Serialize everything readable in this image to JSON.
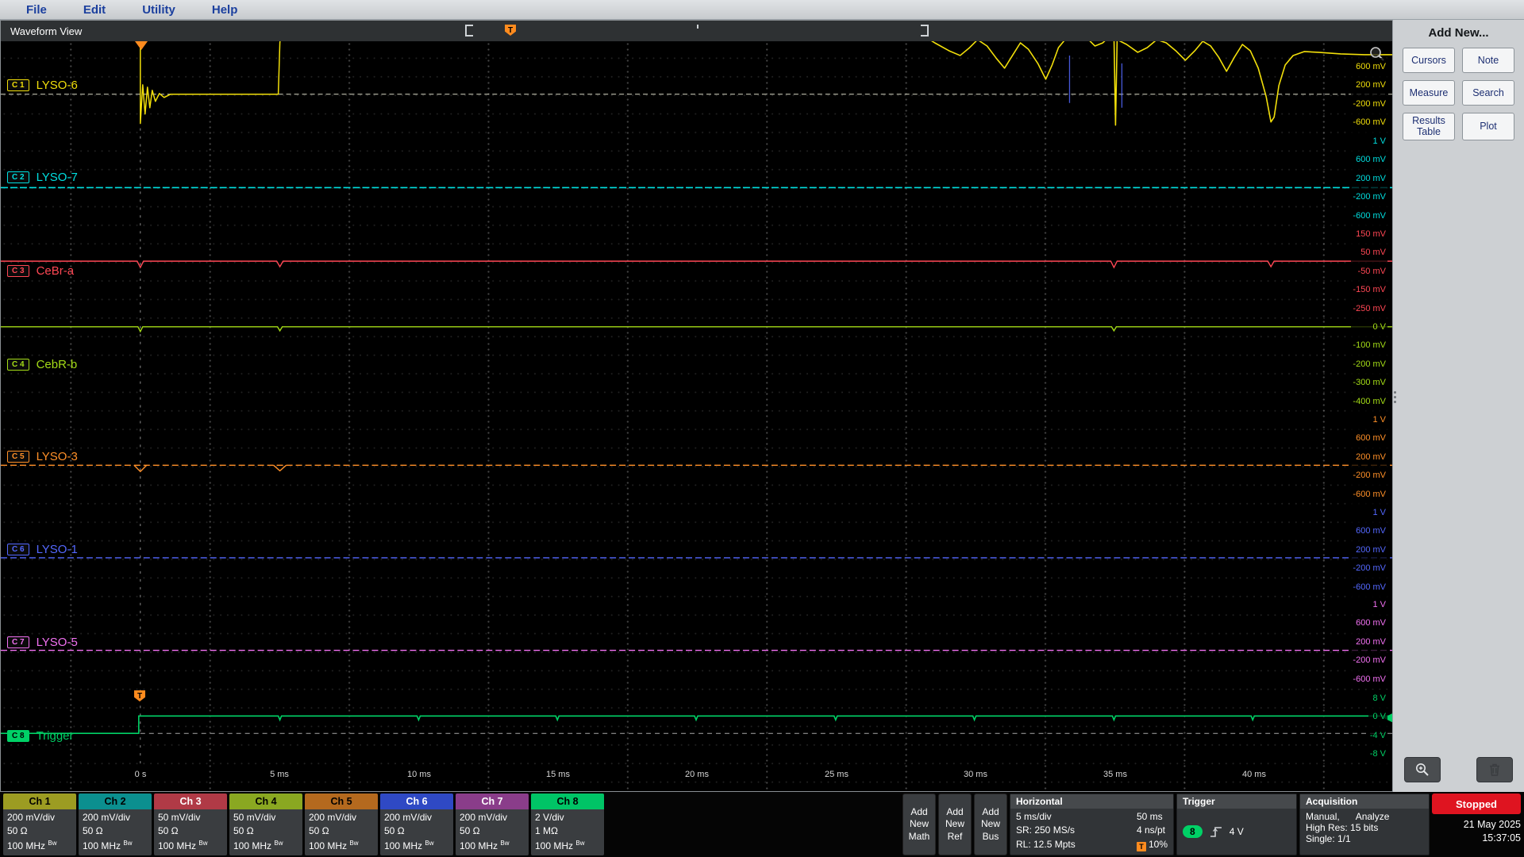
{
  "menu": {
    "items": [
      "File",
      "Edit",
      "Utility",
      "Help"
    ]
  },
  "waveform_view": {
    "title": "Waveform View"
  },
  "sidebar": {
    "title": "Add New...",
    "buttons": [
      "Cursors",
      "Note",
      "Measure",
      "Search",
      "Results Table",
      "Plot"
    ]
  },
  "plot": {
    "channels": [
      {
        "badge": "C 1",
        "name": "LYSO-6",
        "color": "#f2df0a",
        "scale_labels": [
          "600 mV",
          "200 mV",
          "-200 mV",
          "-600 mV"
        ]
      },
      {
        "badge": "C 2",
        "name": "LYSO-7",
        "color": "#00dfe0",
        "scale_labels": [
          "1 V",
          "600 mV",
          "200 mV",
          "-200 mV",
          "-600 mV"
        ]
      },
      {
        "badge": "C 3",
        "name": "CeBr-a",
        "color": "#ff4754",
        "scale_labels": [
          "150 mV",
          "50 mV",
          "-50 mV",
          "-150 mV",
          "-250 mV"
        ]
      },
      {
        "badge": "C 4",
        "name": "CebR-b",
        "color": "#a4dc17",
        "scale_labels": [
          "0 V",
          "-100 mV",
          "-200 mV",
          "-300 mV",
          "-400 mV"
        ]
      },
      {
        "badge": "C 5",
        "name": "LYSO-3",
        "color": "#ff9028",
        "scale_labels": [
          "1 V",
          "600 mV",
          "200 mV",
          "-200 mV",
          "-600 mV"
        ]
      },
      {
        "badge": "C 6",
        "name": "LYSO-1",
        "color": "#5468ff",
        "scale_labels": [
          "1 V",
          "600 mV",
          "200 mV",
          "-200 mV",
          "-600 mV"
        ]
      },
      {
        "badge": "C 7",
        "name": "LYSO-5",
        "color": "#f271f2",
        "scale_labels": [
          "1 V",
          "600 mV",
          "200 mV",
          "-200 mV",
          "-600 mV"
        ]
      },
      {
        "badge": "C 8",
        "name": "Trigger",
        "color": "#00d166",
        "scale_labels": [
          "8 V",
          "",
          "0 V",
          "-4 V",
          "-8 V"
        ]
      }
    ],
    "time_labels": [
      "0 s",
      "5 ms",
      "10 ms",
      "15 ms",
      "20 ms",
      "25 ms",
      "30 ms",
      "35 ms",
      "40 ms"
    ],
    "trigger_marker": {
      "label": "T",
      "color": "#ff8b1e"
    }
  },
  "bottom": {
    "channels": [
      {
        "label": "Ch 1",
        "scale": "200 mV/div",
        "impedance": "50 Ω",
        "bandwidth": "100 MHz",
        "bw": "Bw",
        "color": "#9c9c22"
      },
      {
        "label": "Ch 2",
        "scale": "200 mV/div",
        "impedance": "50 Ω",
        "bandwidth": "100 MHz",
        "bw": "Bw",
        "color": "#0b8f8f"
      },
      {
        "label": "Ch 3",
        "scale": "50 mV/div",
        "impedance": "50 Ω",
        "bandwidth": "100 MHz",
        "bw": "Bw",
        "color": "#b03a46"
      },
      {
        "label": "Ch 4",
        "scale": "50 mV/div",
        "impedance": "50 Ω",
        "bandwidth": "100 MHz",
        "bw": "Bw",
        "color": "#8aa821"
      },
      {
        "label": "Ch 5",
        "scale": "200 mV/div",
        "impedance": "50 Ω",
        "bandwidth": "100 MHz",
        "bw": "Bw",
        "color": "#b4691e"
      },
      {
        "label": "Ch 6",
        "scale": "200 mV/div",
        "impedance": "50 Ω",
        "bandwidth": "100 MHz",
        "bw": "Bw",
        "color": "#2f49c4"
      },
      {
        "label": "Ch 7",
        "scale": "200 mV/div",
        "impedance": "50 Ω",
        "bandwidth": "100 MHz",
        "bw": "Bw",
        "color": "#8a3d8a"
      },
      {
        "label": "Ch 8",
        "scale": "2 V/div",
        "impedance": "1 MΩ",
        "bandwidth": "100 MHz",
        "bw": "Bw",
        "color": "#00c466"
      }
    ],
    "add_buttons": [
      "Add\nNew\nMath",
      "Add\nNew\nRef",
      "Add\nNew\nBus"
    ],
    "horizontal": {
      "title": "Horizontal",
      "scale": "5 ms/div",
      "window": "50 ms",
      "sample_rate": "SR: 250 MS/s",
      "sample_interval": "4 ns/pt",
      "record_length": "RL: 12.5 Mpts",
      "position_icon": "T",
      "position": "10%"
    },
    "trigger": {
      "title": "Trigger",
      "source_badge": "8",
      "level": "4 V"
    },
    "acquisition": {
      "title": "Acquisition",
      "mode": "Manual,",
      "analyze": "Analyze",
      "detail": "High Res: 15 bits",
      "single": "Single: 1/1"
    },
    "status": {
      "label": "Stopped",
      "color": "#df1420"
    },
    "datetime": {
      "date": "21 May 2025",
      "time": "15:37:05"
    }
  }
}
